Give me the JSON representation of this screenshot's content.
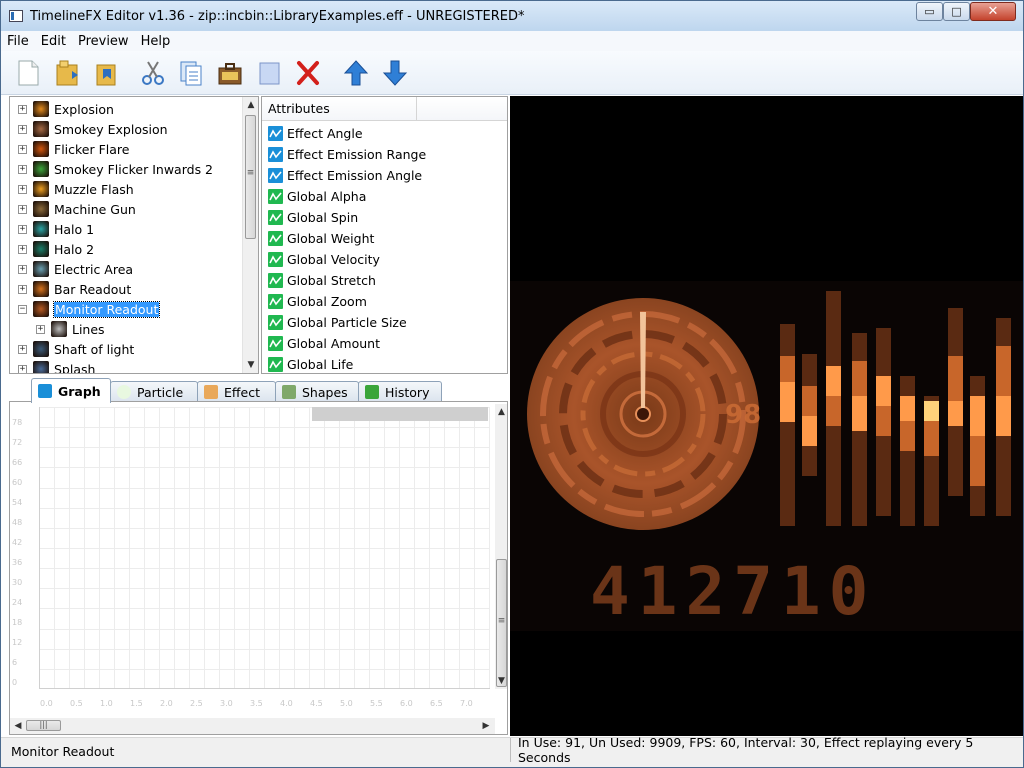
{
  "window": {
    "title": "TimelineFX Editor v1.36 - zip::incbin::LibraryExamples.eff - UNREGISTERED*",
    "min_glyph": "▭",
    "max_glyph": "□",
    "close_glyph": "✕"
  },
  "menu": [
    "File",
    "Edit",
    "Preview",
    "Help"
  ],
  "toolbar": [
    {
      "name": "new-button",
      "icon": "new-file-icon"
    },
    {
      "name": "open-button",
      "icon": "folder-open-icon"
    },
    {
      "name": "save-button",
      "icon": "folder-save-icon"
    },
    {
      "name": "cut-button",
      "icon": "scissors-icon"
    },
    {
      "name": "copy-button",
      "icon": "copy-icon"
    },
    {
      "name": "paste-button",
      "icon": "briefcase-icon"
    },
    {
      "name": "clone-button",
      "icon": "page-icon"
    },
    {
      "name": "delete-button",
      "icon": "red-x-icon"
    },
    {
      "name": "move-up-button",
      "icon": "arrow-up-icon"
    },
    {
      "name": "move-down-button",
      "icon": "arrow-down-icon"
    }
  ],
  "library_tree": {
    "items": [
      {
        "label": "Explosion",
        "expander": "+",
        "color": "#e58b1c"
      },
      {
        "label": "Smokey Explosion",
        "expander": "+",
        "color": "#a66a45"
      },
      {
        "label": "Flicker Flare",
        "expander": "+",
        "color": "#d4560d"
      },
      {
        "label": "Smokey Flicker Inwards 2",
        "expander": "+",
        "color": "#3aa53a"
      },
      {
        "label": "Muzzle Flash",
        "expander": "+",
        "color": "#f0a020"
      },
      {
        "label": "Machine Gun",
        "expander": "+",
        "color": "#8c6a3a"
      },
      {
        "label": "Halo 1",
        "expander": "+",
        "color": "#2aa6a6"
      },
      {
        "label": "Halo 2",
        "expander": "+",
        "color": "#1a7f6a"
      },
      {
        "label": "Electric Area",
        "expander": "+",
        "color": "#6aa1b3"
      },
      {
        "label": "Bar Readout",
        "expander": "+",
        "color": "#d9731c"
      },
      {
        "label": "Monitor Readout",
        "expander": "−",
        "color": "#b85a22",
        "selected": true
      },
      {
        "label": "Lines",
        "expander": "+",
        "color": "#bdbdbd",
        "child": true
      },
      {
        "label": "Shaft of light",
        "expander": "+",
        "color": "#3b5a78"
      },
      {
        "label": "Splash",
        "expander": "+",
        "color": "#4a6c9a"
      }
    ],
    "scroll_up": "▲",
    "scroll_down": "▼",
    "grip": "≡"
  },
  "attributes": {
    "header": "Attributes",
    "items": [
      {
        "label": "Effect Angle",
        "kind": "blue"
      },
      {
        "label": "Effect Emission Range",
        "kind": "blue"
      },
      {
        "label": "Effect Emission Angle",
        "kind": "blue"
      },
      {
        "label": "Global Alpha",
        "kind": "green"
      },
      {
        "label": "Global Spin",
        "kind": "green"
      },
      {
        "label": "Global Weight",
        "kind": "green"
      },
      {
        "label": "Global Velocity",
        "kind": "green"
      },
      {
        "label": "Global Stretch",
        "kind": "green"
      },
      {
        "label": "Global Zoom",
        "kind": "green"
      },
      {
        "label": "Global Particle Size",
        "kind": "green"
      },
      {
        "label": "Global Amount",
        "kind": "green"
      },
      {
        "label": "Global Life",
        "kind": "green"
      }
    ]
  },
  "tabs": [
    {
      "label": "Graph",
      "active": true,
      "icon": "graph-icon"
    },
    {
      "label": "Particle",
      "active": false,
      "icon": "particle-icon"
    },
    {
      "label": "Effect",
      "active": false,
      "icon": "effect-icon"
    },
    {
      "label": "Shapes",
      "active": false,
      "icon": "shapes-icon"
    },
    {
      "label": "History",
      "active": false,
      "icon": "history-icon"
    }
  ],
  "graph": {
    "y_labels": [
      "78",
      "72",
      "66",
      "60",
      "54",
      "48",
      "42",
      "36",
      "30",
      "24",
      "18",
      "12",
      "6",
      "0"
    ],
    "x_labels": [
      "0.0",
      "0.5",
      "1.0",
      "1.5",
      "2.0",
      "2.5",
      "3.0",
      "3.5",
      "4.0",
      "4.5",
      "5.0",
      "5.5",
      "6.0",
      "6.5",
      "7.0"
    ],
    "scroll_up": "▲",
    "scroll_down": "▼",
    "scroll_left": "◀",
    "scroll_right": "▶",
    "grip": "≡",
    "hgrip": "|||"
  },
  "preview": {
    "dial_value": "98",
    "counter": "412710",
    "colors": {
      "bright": "#ff9a4a",
      "mid": "#c8662a",
      "dark": "#5a2a12"
    }
  },
  "status": {
    "left": "Monitor Readout",
    "right": "In Use: 91, Un Used: 9909, FPS: 60, Interval: 30, Effect replaying every 5 Seconds"
  }
}
